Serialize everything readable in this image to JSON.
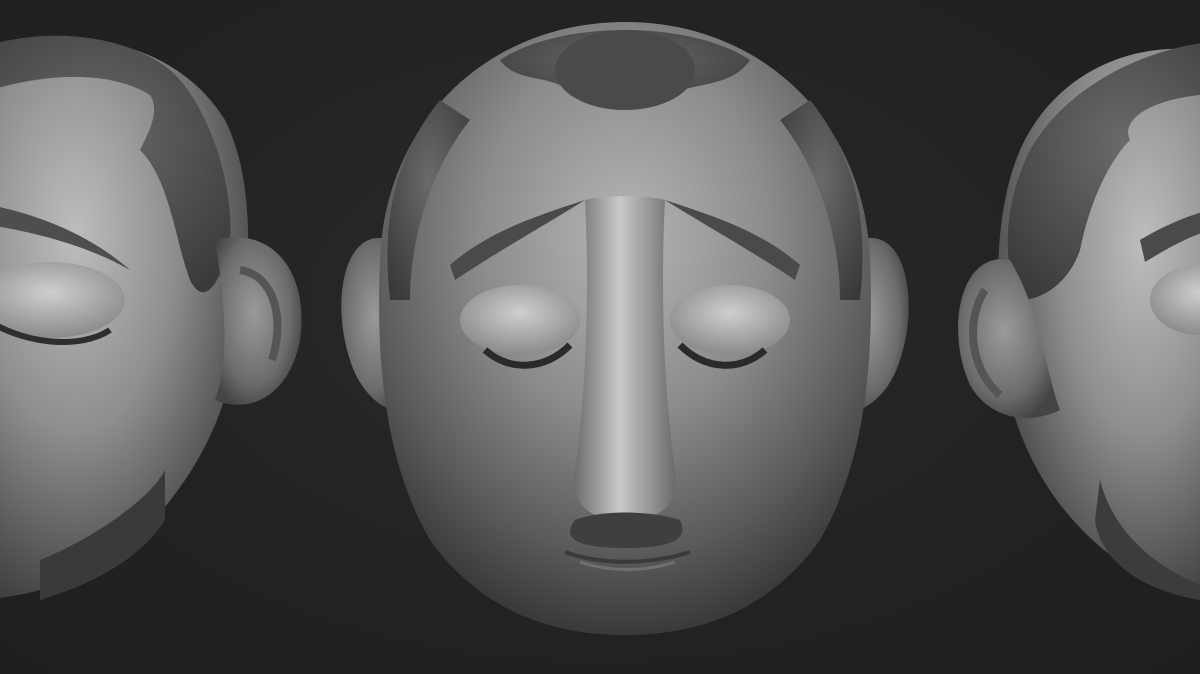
{
  "scene": {
    "background_color": "#232323",
    "material_color": "#8a8a8a",
    "views": [
      {
        "id": "left",
        "kind": "three-quarter-left"
      },
      {
        "id": "front",
        "kind": "front"
      },
      {
        "id": "right",
        "kind": "three-quarter-right"
      }
    ]
  }
}
